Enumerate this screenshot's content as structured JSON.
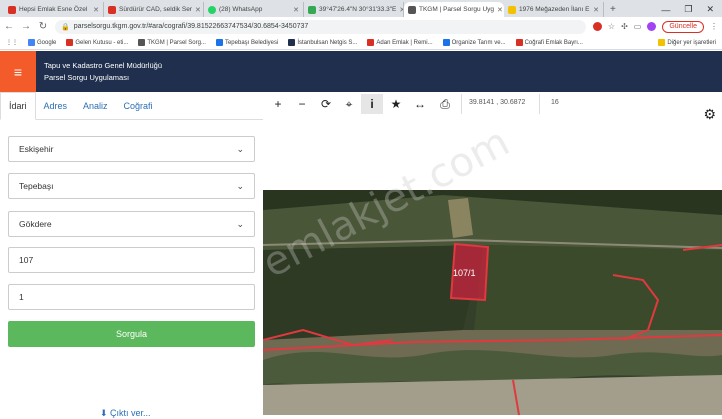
{
  "browser": {
    "tabs": [
      {
        "label": "Hepsi Emlak Esne Özel",
        "color": "#d93025"
      },
      {
        "label": "Sürdürür CAD, seldik Ser",
        "color": "#d93025"
      },
      {
        "label": "(28) WhatsApp",
        "color": "#25d366"
      },
      {
        "label": "39°47'26.4\"N 30°31'33.3\"E",
        "color": "#34a853"
      },
      {
        "label": "TKGM | Parsel Sorgu Uyg",
        "color": "#555555"
      },
      {
        "label": "1976 Meğazeden İlanı E",
        "color": "#f2c200"
      }
    ],
    "new_tab": "+",
    "url": "parselsorgu.tkgm.gov.tr/#ara/cografi/39.81522663747534/30.6854-3450737",
    "update_label": "Güncelle",
    "bookmarks": [
      {
        "label": "Google",
        "color": "#4285f4"
      },
      {
        "label": "Gelen Kutusu - eti...",
        "color": "#d93025"
      },
      {
        "label": "TKGM | Parsel Sorg...",
        "color": "#555555"
      },
      {
        "label": "Tepebaşı Belediyesi",
        "color": "#1a73e8"
      },
      {
        "label": "İstanbulsan Netgis S...",
        "color": "#1f2f4d"
      },
      {
        "label": "Adan Emlak | Remi...",
        "color": "#d93025"
      },
      {
        "label": "Organize Tarım ve...",
        "color": "#1a73e8"
      },
      {
        "label": "Coğrafi Emlak Bayrı...",
        "color": "#d93025"
      }
    ],
    "bookmarks_right": "Diğer yer işaretleri"
  },
  "app": {
    "title_line1": "Tapu ve Kadastro Genel Müdürlüğü",
    "title_line2": "Parsel Sorgu Uygulaması",
    "accent": "#f35b2a",
    "header_bg": "#1f2f4d"
  },
  "panel": {
    "tabs": [
      "İdari",
      "Adres",
      "Analiz",
      "Coğrafi"
    ],
    "il": "Eskişehir",
    "ilce": "Tepebaşı",
    "mahalle": "Gökdere",
    "ada": "107",
    "parsel": "1",
    "query_button": "Sorgula",
    "bottom_text": "⬇ Çıktı ver..."
  },
  "toolbar": {
    "coords": "39.8141 , 30.6872",
    "zoom": "16"
  },
  "map": {
    "parcel_label": "107/1",
    "watermark": "emlakjet.com"
  }
}
